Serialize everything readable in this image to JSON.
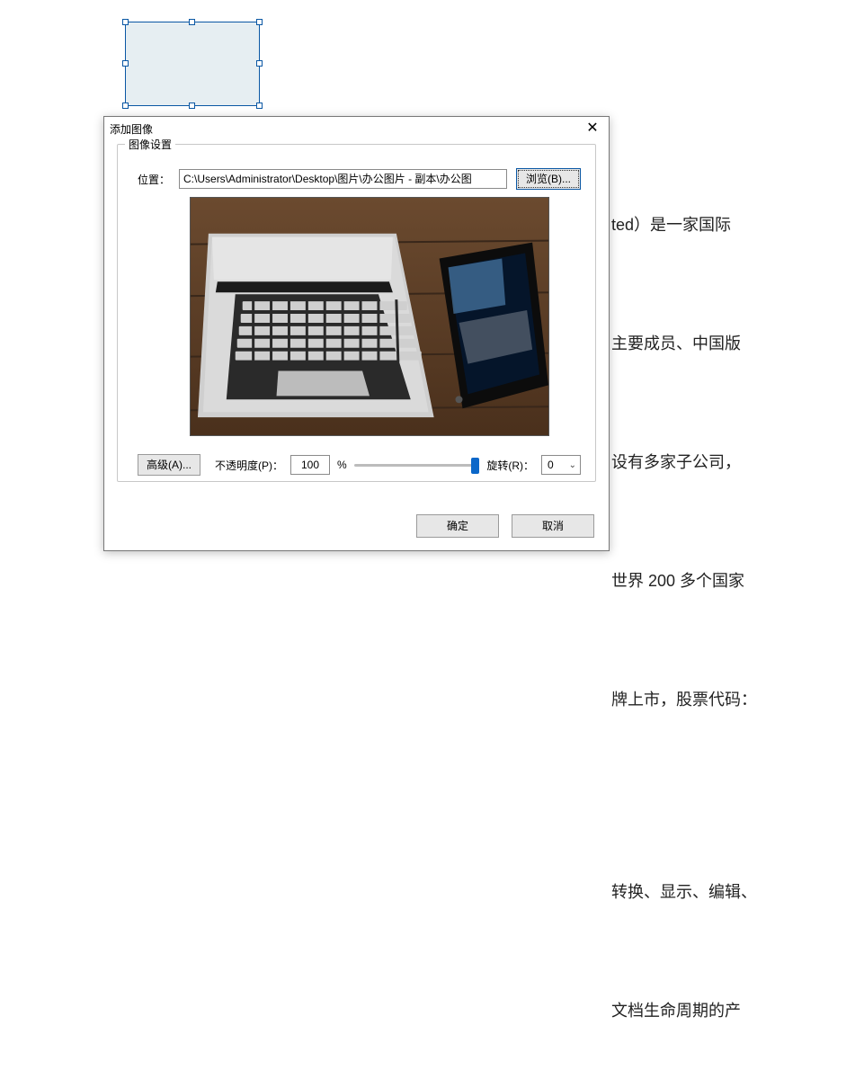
{
  "background_text": {
    "l1": "ted）是一家国际",
    "l2": "主要成员、中国版",
    "l3": "设有多家子公司，",
    "l4": "世界 200 多个国家",
    "l5": "牌上市，股票代码：",
    "l6": "转换、显示、编辑、",
    "l7": "文档生命周期的产"
  },
  "dialog": {
    "title": "添加图像",
    "fieldset_label": "图像设置",
    "location_label": "位置：",
    "path_value": "C:\\Users\\Administrator\\Desktop\\图片\\办公图片 - 副本\\办公图",
    "browse_label": "浏览(B)...",
    "advanced_label": "高级(A)...",
    "opacity_label": "不透明度(P)：",
    "opacity_value": "100",
    "opacity_percent": "%",
    "rotate_label": "旋转(R)：",
    "rotate_value": "0",
    "ok_label": "确定",
    "cancel_label": "取消"
  }
}
